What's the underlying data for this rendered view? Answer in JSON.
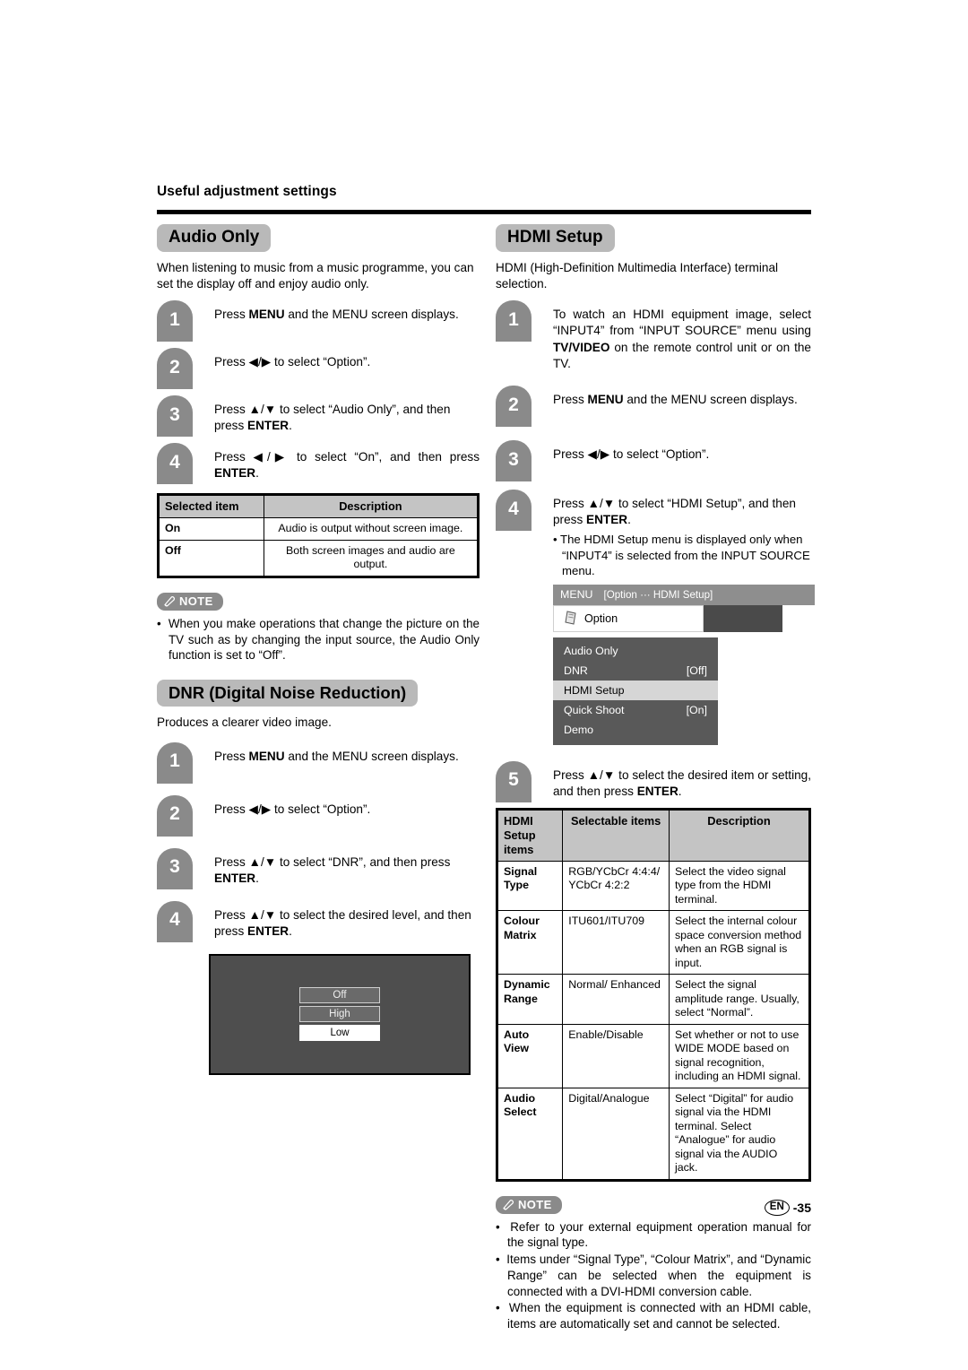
{
  "header": {
    "running_head": "Useful adjustment settings"
  },
  "left_column": {
    "audio_only": {
      "title": "Audio Only",
      "intro": "When listening to music from a music programme, you can set the display off and enjoy audio only.",
      "steps": [
        {
          "num": "1",
          "text": "Press MENU and the MENU screen displays."
        },
        {
          "num": "2",
          "text": "Press ◀/▶ to select “Option”."
        },
        {
          "num": "3",
          "text": "Press ▲/▼ to select “Audio Only”, and then press ENTER."
        },
        {
          "num": "4",
          "text": "Press ◀/▶ to select “On”, and then press ENTER."
        }
      ],
      "table": {
        "headers": [
          "Selected item",
          "Description"
        ],
        "rows": [
          [
            "On",
            "Audio is output without screen image."
          ],
          [
            "Off",
            "Both screen images and audio are output."
          ]
        ]
      },
      "note": {
        "label": "NOTE",
        "items": [
          "When you make operations that change the picture on the TV such as by changing the input source, the Audio Only function is set to “Off”."
        ]
      }
    },
    "dnr": {
      "title": "DNR (Digital Noise Reduction)",
      "intro": "Produces a clearer video image.",
      "steps": [
        {
          "num": "1",
          "text": "Press MENU and the MENU screen displays."
        },
        {
          "num": "2",
          "text": "Press ◀/▶ to select “Option”."
        },
        {
          "num": "3",
          "text": "Press ▲/▼ to select “DNR”, and then press ENTER."
        },
        {
          "num": "4",
          "text": "Press ▲/▼ to select the desired level, and then press ENTER."
        }
      ],
      "screenshot": {
        "options": [
          {
            "label": "Off",
            "selected": false
          },
          {
            "label": "High",
            "selected": false
          },
          {
            "label": "Low",
            "selected": true
          }
        ]
      }
    }
  },
  "right_column": {
    "hdmi_setup": {
      "title": "HDMI Setup",
      "intro": "HDMI (High-Definition Multimedia Interface) terminal selection.",
      "steps": [
        {
          "num": "1",
          "text": "To watch an HDMI equipment image, select “INPUT4” from “INPUT SOURCE” menu using TV/VIDEO on the remote control unit or on the TV."
        },
        {
          "num": "2",
          "text": "Press MENU and the MENU screen displays."
        },
        {
          "num": "3",
          "text": "Press ◀/▶ to select “Option”."
        },
        {
          "num": "4",
          "text": "Press ▲/▼ to select “HDMI Setup”, and then press ENTER."
        },
        {
          "num": "5",
          "text": "Press ▲/▼ to select the desired item or setting, and then press ENTER."
        }
      ],
      "step4_bullet": "• The HDMI Setup menu is displayed only when “INPUT4” is selected from the INPUT SOURCE menu.",
      "menu_screenshot": {
        "menubar_title": "MENU",
        "breadcrumb": "[Option ··· HDMI Setup]",
        "tab_label": "Option",
        "items": [
          {
            "label": "Audio Only",
            "value": "",
            "selected": false
          },
          {
            "label": "DNR",
            "value": "[Off]",
            "selected": false
          },
          {
            "label": "HDMI Setup",
            "value": "",
            "selected": true
          },
          {
            "label": "Quick Shoot",
            "value": "[On]",
            "selected": false
          },
          {
            "label": "Demo",
            "value": "",
            "selected": false
          }
        ]
      },
      "table": {
        "headers": [
          "HDMI Setup items",
          "Selectable items",
          "Description"
        ],
        "rows": [
          [
            "Signal Type",
            "RGB/YCbCr 4:4:4/\nYCbCr 4:2:2",
            "Select the video signal type from the HDMI terminal."
          ],
          [
            "Colour Matrix",
            "ITU601/ITU709",
            "Select the internal colour space conversion method when an RGB signal is input."
          ],
          [
            "Dynamic Range",
            "Normal/\nEnhanced",
            "Select the signal amplitude range. Usually, select “Normal”."
          ],
          [
            "Auto View",
            "Enable/Disable",
            "Set whether or not to use WIDE MODE based on signal recognition, including an HDMI signal."
          ],
          [
            "Audio Select",
            "Digital/Analogue",
            "Select “Digital” for audio signal via the HDMI terminal. Select “Analogue” for audio signal via the AUDIO jack."
          ]
        ]
      },
      "note": {
        "label": "NOTE",
        "items": [
          "Refer to your external equipment operation manual for the signal type.",
          "Items under “Signal Type”, “Colour Matrix”, and “Dynamic Range” can be selected when the equipment is connected with a DVI-HDMI conversion cable.",
          "When the equipment is connected with an HDMI cable, items are automatically set and cannot be selected."
        ]
      }
    }
  },
  "footer": {
    "lang": "EN",
    "page": "-35"
  }
}
